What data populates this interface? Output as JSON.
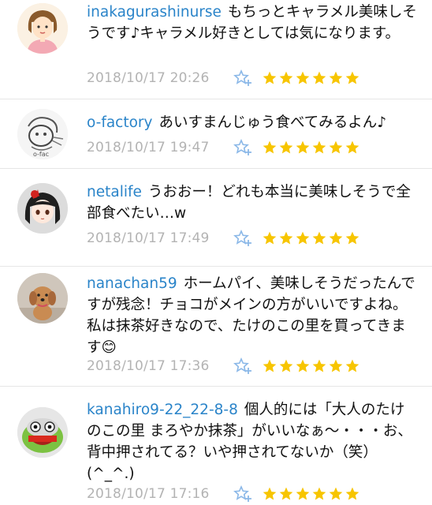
{
  "comments": [
    {
      "username": "inakagurashinurse",
      "text": "もちっとキャラメル美味しそうです♪キャラメル好きとしては気になります。",
      "timestamp": "2018/10/17 20:26",
      "rating": 6,
      "avatar_icon": "illustrated-woman-avatar"
    },
    {
      "username": "o-factory",
      "text": "あいすまんじゅう食べてみるよん♪",
      "timestamp": "2018/10/17 19:47",
      "rating": 6,
      "avatar_icon": "sketch-illustration-avatar"
    },
    {
      "username": "netalife",
      "text": "うおおー！どれも本当に美味しそうで全部食べたい…w",
      "timestamp": "2018/10/17 17:49",
      "rating": 6,
      "avatar_icon": "anime-girl-avatar"
    },
    {
      "username": "nanachan59",
      "text": "ホームパイ、美味しそうだったんですが残念！チョコがメインの方がいいですよね。私は抹茶好きなので、たけのこの里を買ってきます😊",
      "timestamp": "2018/10/17 17:36",
      "rating": 6,
      "avatar_icon": "dog-photo-avatar"
    },
    {
      "username": "kanahiro9-22_22-8-8",
      "text": "個人的には「大人のたけのこの里 まろやか抹茶」がいいなぁ〜・・・お、背中押されてる？いや押されてないか（笑）(^_^.)",
      "timestamp": "2018/10/17 17:16",
      "rating": 6,
      "avatar_icon": "green-face-character-avatar"
    }
  ],
  "colors": {
    "username": "#2a84c9",
    "star_filled": "#f7c500",
    "fav_icon": "#8bb8e8",
    "timestamp": "#b3b3b3"
  }
}
